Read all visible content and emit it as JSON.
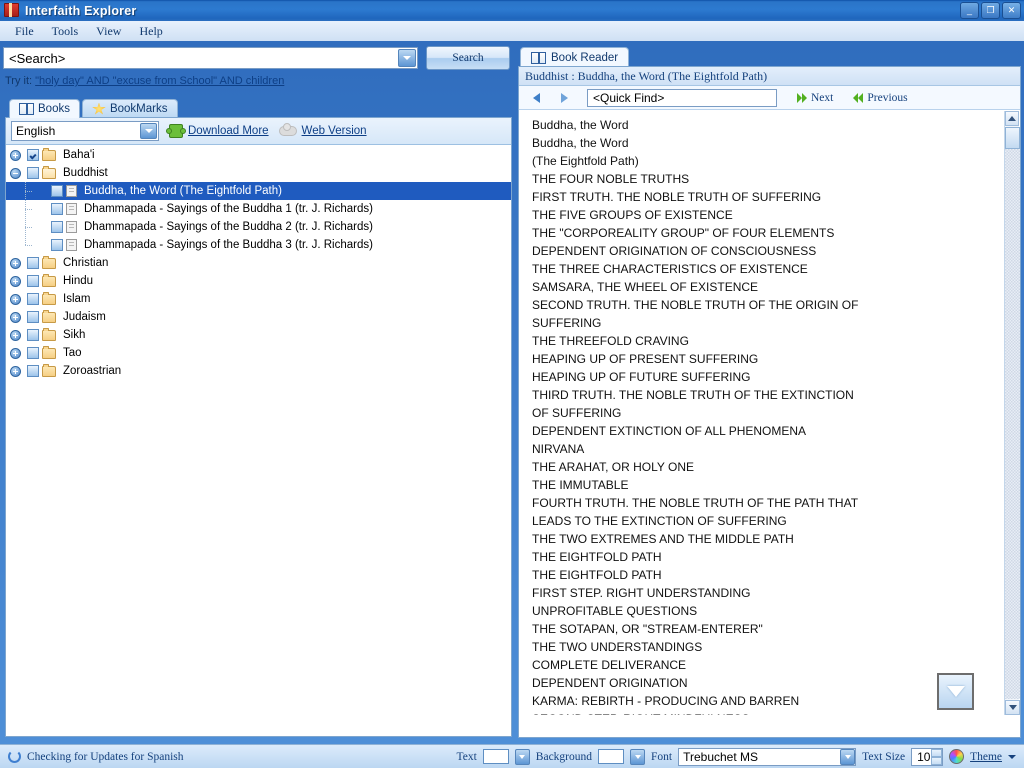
{
  "window": {
    "title": "Interfaith Explorer",
    "icon": "app-book-icon",
    "buttons": {
      "minimize": "_",
      "maximize": "❐",
      "close": "✕"
    }
  },
  "menu": {
    "items": [
      "File",
      "Tools",
      "View",
      "Help"
    ]
  },
  "search": {
    "value": "<Search>",
    "placeholder": "<Search>",
    "button_label": "Search",
    "try_it_label": "Try it:",
    "try_it_link": "\"holy day\" AND \"excuse from School\" AND children"
  },
  "left_tabs": [
    {
      "label": "Books",
      "icon": "book-icon",
      "active": true
    },
    {
      "label": "BookMarks",
      "icon": "star-icon",
      "active": false
    }
  ],
  "library_toolbar": {
    "language": "English",
    "download_more": "Download More",
    "web_version": "Web Version",
    "puzzle_icon": "puzzle-icon",
    "cloud_icon": "cloud-icon"
  },
  "tree": [
    {
      "label": "Baha'i",
      "depth": 0,
      "type": "folder",
      "expander": "plus",
      "checked": true,
      "selected": false
    },
    {
      "label": "Buddhist",
      "depth": 0,
      "type": "folder-open",
      "expander": "minus",
      "checked": false,
      "selected": false
    },
    {
      "label": "Buddha,  the Word (The Eightfold Path)",
      "depth": 1,
      "type": "doc",
      "expander": "none",
      "checked": false,
      "selected": true
    },
    {
      "label": "Dhammapada - Sayings of the Buddha 1 (tr. J. Richards)",
      "depth": 1,
      "type": "doc",
      "expander": "none",
      "checked": false,
      "selected": false
    },
    {
      "label": "Dhammapada - Sayings of the Buddha 2 (tr. J. Richards)",
      "depth": 1,
      "type": "doc",
      "expander": "none",
      "checked": false,
      "selected": false
    },
    {
      "label": "Dhammapada - Sayings of the Buddha 3 (tr. J. Richards)",
      "depth": 1,
      "type": "doc",
      "expander": "none",
      "checked": false,
      "selected": false
    },
    {
      "label": "Christian",
      "depth": 0,
      "type": "folder",
      "expander": "plus",
      "checked": false,
      "selected": false
    },
    {
      "label": "Hindu",
      "depth": 0,
      "type": "folder",
      "expander": "plus",
      "checked": false,
      "selected": false
    },
    {
      "label": "Islam",
      "depth": 0,
      "type": "folder",
      "expander": "plus",
      "checked": false,
      "selected": false
    },
    {
      "label": "Judaism",
      "depth": 0,
      "type": "folder",
      "expander": "plus",
      "checked": false,
      "selected": false
    },
    {
      "label": "Sikh",
      "depth": 0,
      "type": "folder",
      "expander": "plus",
      "checked": false,
      "selected": false
    },
    {
      "label": "Tao",
      "depth": 0,
      "type": "folder",
      "expander": "plus",
      "checked": false,
      "selected": false
    },
    {
      "label": "Zoroastrian",
      "depth": 0,
      "type": "folder",
      "expander": "plus",
      "checked": false,
      "selected": false
    }
  ],
  "reader": {
    "tab_label": "Book Reader",
    "tab_icon": "book-icon",
    "breadcrumb": "Buddhist : Buddha,  the Word (The Eightfold Path)",
    "quick_find_value": "<Quick Find>",
    "quick_find_placeholder": "<Quick Find>",
    "next_label": "Next",
    "previous_label": "Previous",
    "back_icon": "triangle-left-icon",
    "forward_icon": "triangle-right-icon",
    "scroll_down_overlay_icon": "arrow-down-icon",
    "lines": [
      "Buddha, the Word",
      "Buddha, the Word",
      "(The Eightfold Path)",
      "THE FOUR NOBLE TRUTHS",
      "FIRST TRUTH. THE NOBLE TRUTH OF SUFFERING",
      "THE FIVE GROUPS OF EXISTENCE",
      "THE \"CORPOREALITY GROUP\" OF FOUR ELEMENTS",
      "DEPENDENT ORIGINATION OF CONSCIOUSNESS",
      "THE THREE CHARACTERISTICS OF EXISTENCE",
      "SAMSARA, THE WHEEL OF EXISTENCE",
      "SECOND TRUTH. THE NOBLE TRUTH OF THE ORIGIN OF",
      "SUFFERING",
      "THE THREEFOLD CRAVING",
      "HEAPING UP OF PRESENT SUFFERING",
      "HEAPING UP OF FUTURE SUFFERING",
      "THIRD TRUTH. THE NOBLE TRUTH OF THE EXTINCTION",
      "OF SUFFERING",
      "DEPENDENT EXTINCTION OF ALL PHENOMENA",
      "NIRVANA",
      "THE ARAHAT, OR HOLY ONE",
      "THE IMMUTABLE",
      "FOURTH TRUTH. THE NOBLE TRUTH OF THE PATH THAT",
      "LEADS TO THE EXTINCTION OF SUFFERING",
      "THE TWO EXTREMES AND THE MIDDLE PATH",
      "THE EIGHTFOLD PATH",
      "THE EIGHTFOLD PATH",
      "FIRST STEP. RIGHT UNDERSTANDING",
      "UNPROFITABLE QUESTIONS",
      "THE SOTAPAN, OR \"STREAM-ENTERER\"",
      "THE TWO UNDERSTANDINGS",
      "COMPLETE DELIVERANCE",
      "DEPENDENT ORIGINATION",
      "KARMA: REBIRTH - PRODUCING AND BARREN",
      "SECOND STEP. RIGHT MINDFULNESS"
    ]
  },
  "statusbar": {
    "status_text": "Checking for Updates for Spanish",
    "refresh_icon": "refresh-icon",
    "text_label": "Text",
    "background_label": "Background",
    "font_label": "Font",
    "font_value": "Trebuchet MS",
    "text_size_label": "Text Size",
    "text_size_value": "10",
    "theme_label": "Theme",
    "theme_icon": "color-wheel-icon"
  },
  "colors": {
    "accent": "#2d7ad0",
    "selection": "#1f5bbf",
    "link": "#0e3f86",
    "panel_bg": "#ffffff",
    "chrome": "#4f90d8"
  }
}
